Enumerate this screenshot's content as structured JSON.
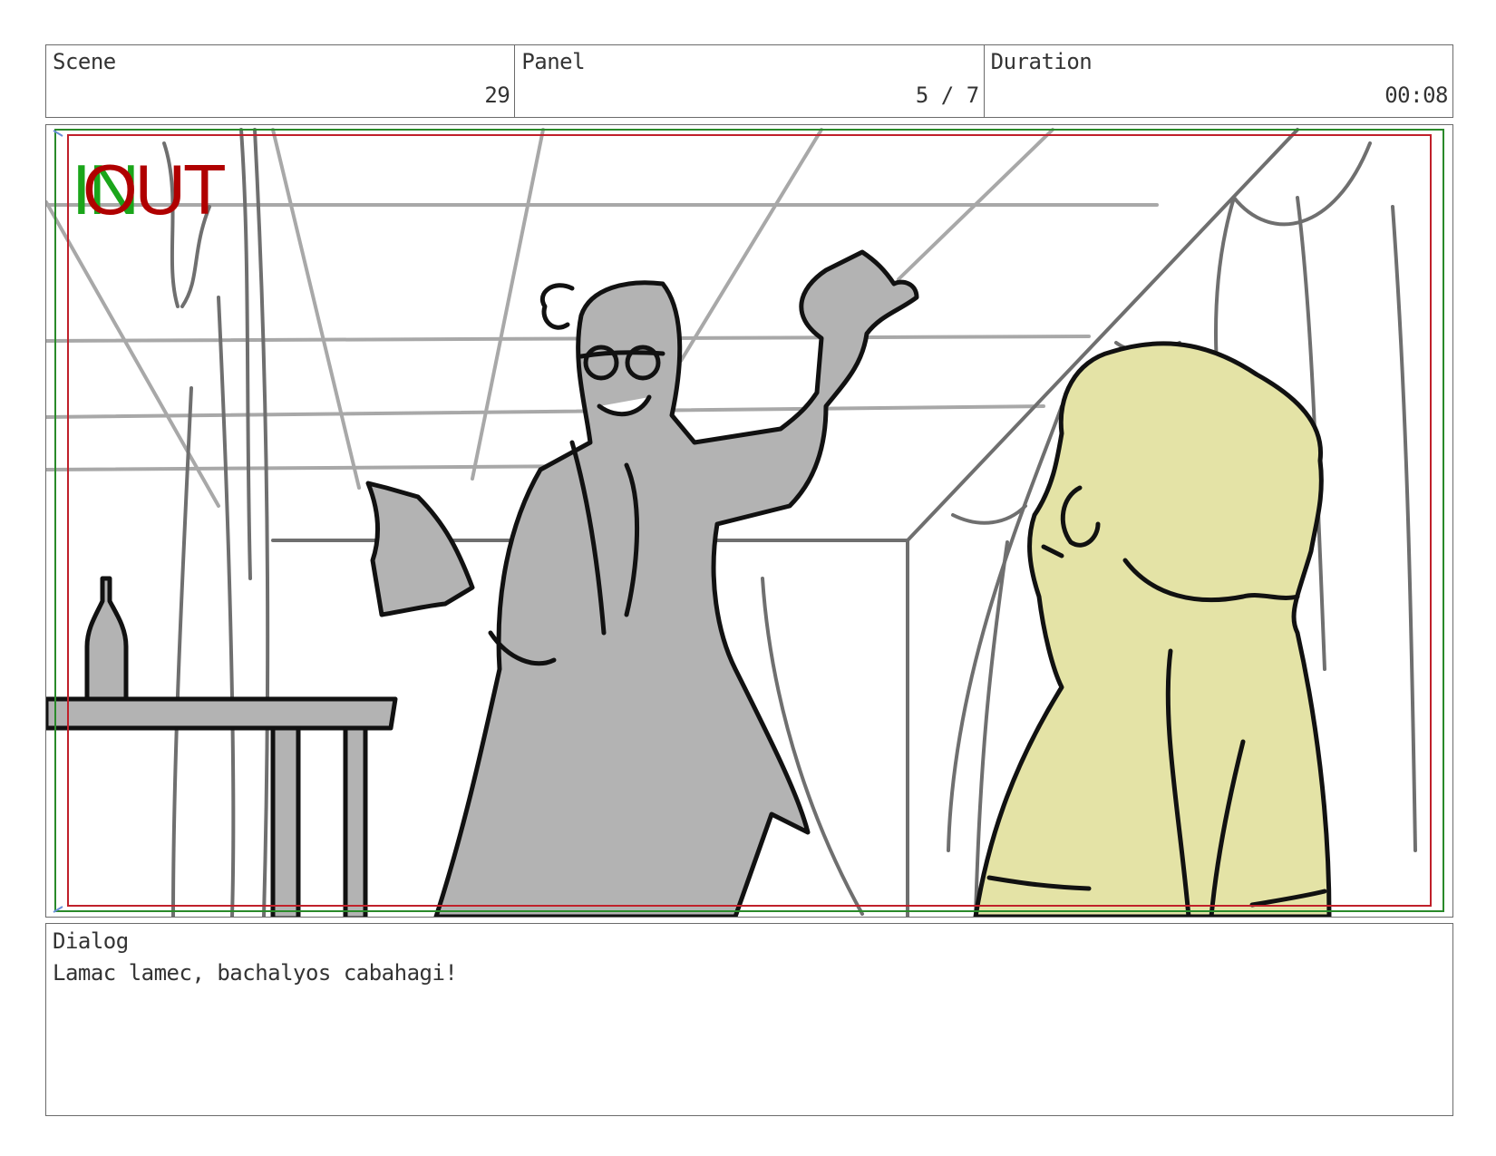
{
  "header": {
    "scene_label": "Scene",
    "scene_value": "29",
    "panel_label": "Panel",
    "panel_value": "5 / 7",
    "duration_label": "Duration",
    "duration_value": "00:08"
  },
  "frame": {
    "marker_in": "IN",
    "marker_out": "OUT",
    "colors": {
      "in_marker": "#1aa51a",
      "out_marker": "#b00000",
      "safe_area_red": "#c0202a",
      "safe_area_green": "#2a8a2a",
      "character_gray": "#b3b3b3",
      "character_yellow": "#e4e3a6"
    }
  },
  "dialog": {
    "label": "Dialog",
    "text": "Lamac lamec, bachalyos cabahagi!"
  }
}
